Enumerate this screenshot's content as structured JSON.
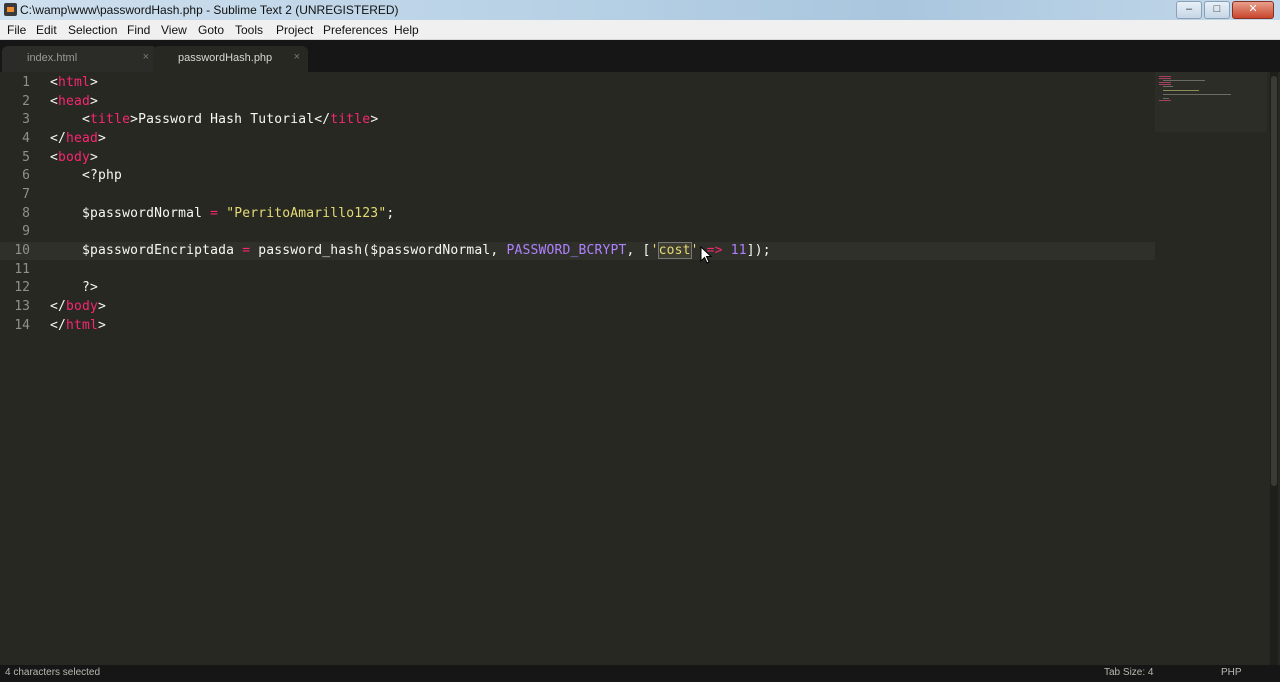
{
  "window": {
    "title": "C:\\wamp\\www\\passwordHash.php - Sublime Text 2 (UNREGISTERED)",
    "controls": {
      "minimize": "–",
      "maximize": "□",
      "close": "✕"
    }
  },
  "menu": [
    "File",
    "Edit",
    "Selection",
    "Find",
    "View",
    "Goto",
    "Tools",
    "Project",
    "Preferences",
    "Help"
  ],
  "tabs": [
    {
      "label": "index.html",
      "close": "×"
    },
    {
      "label": "passwordHash.php",
      "close": "×"
    }
  ],
  "editor": {
    "line_numbers": [
      "1",
      "2",
      "3",
      "4",
      "5",
      "6",
      "7",
      "8",
      "9",
      "10",
      "11",
      "12",
      "13",
      "14"
    ],
    "lines": {
      "l1": {
        "open": "<",
        "tag": "html",
        "close": ">"
      },
      "l2": {
        "open": "<",
        "tag": "head",
        "close": ">"
      },
      "l3": {
        "indent": "    ",
        "open": "<",
        "tag": "title",
        "mid": ">Password Hash Tutorial</",
        "tag2": "title",
        "close": ">"
      },
      "l4": {
        "open": "</",
        "tag": "head",
        "close": ">"
      },
      "l5": {
        "open": "<",
        "tag": "body",
        "close": ">"
      },
      "l6": {
        "text": "    <?php"
      },
      "l8": {
        "indent": "    ",
        "var": "$passwordNormal",
        "eq": "=",
        "str": "\"PerritoAmarillo123\"",
        "end": ";"
      },
      "l10": {
        "indent": "    ",
        "var": "$passwordEncriptada",
        "eq": "=",
        "fn": "password_hash($passwordNormal,",
        "const": "PASSWORD_BCRYPT",
        "punct": ", [",
        "q1": "'",
        "sel": "cost",
        "q2": "'",
        "arrow": "=>",
        "num": "11",
        "end": "]);"
      },
      "l12": {
        "text": "    ?>"
      },
      "l13": {
        "open": "</",
        "tag": "body",
        "close": ">"
      },
      "l14": {
        "open": "</",
        "tag": "html",
        "close": ">"
      }
    }
  },
  "status": {
    "left": "4 characters selected",
    "tab_size": "Tab Size: 4",
    "syntax": "PHP"
  }
}
